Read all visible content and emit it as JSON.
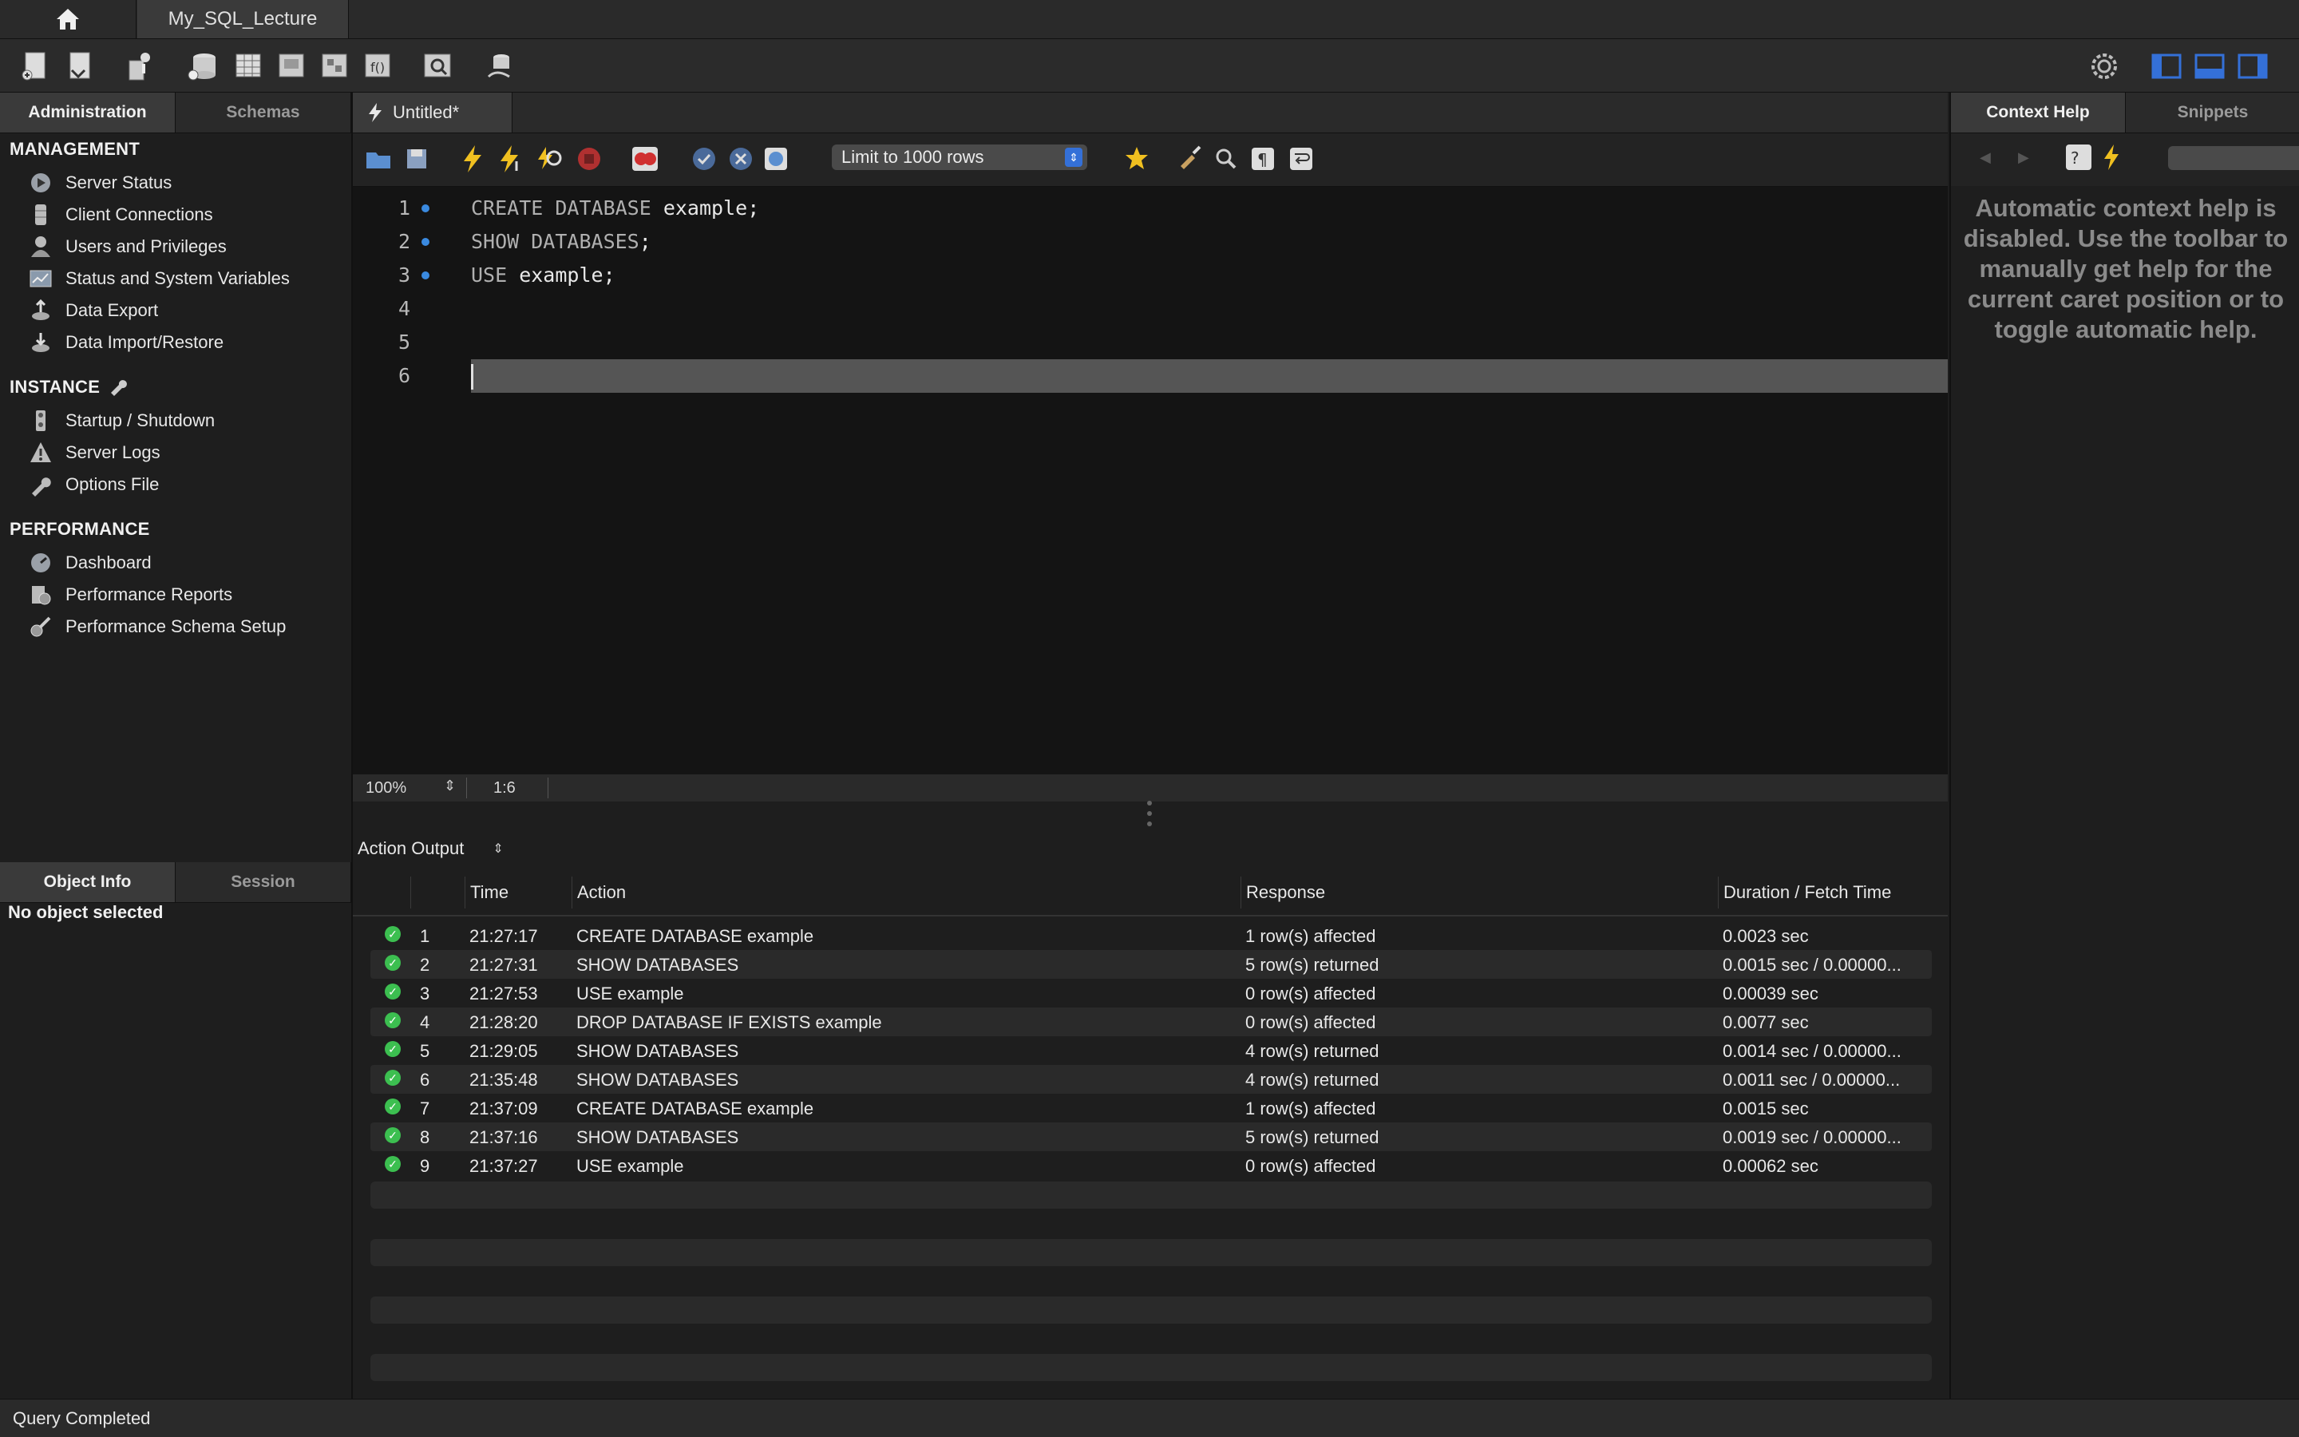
{
  "connection_tab": {
    "label": "My_SQL_Lecture"
  },
  "sidebar": {
    "top_tabs": [
      "Administration",
      "Schemas"
    ],
    "sections": [
      {
        "title": "MANAGEMENT",
        "items": [
          "Server Status",
          "Client Connections",
          "Users and Privileges",
          "Status and System Variables",
          "Data Export",
          "Data Import/Restore"
        ]
      },
      {
        "title": "INSTANCE",
        "items": [
          "Startup / Shutdown",
          "Server Logs",
          "Options File"
        ]
      },
      {
        "title": "PERFORMANCE",
        "items": [
          "Dashboard",
          "Performance Reports",
          "Performance Schema Setup"
        ]
      }
    ],
    "bottom_tabs": [
      "Object Info",
      "Session"
    ],
    "object_info": "No object selected"
  },
  "editor": {
    "tab_label": "Untitled*",
    "limit_label": "Limit to 1000 rows",
    "lines": [
      {
        "num": "1",
        "kw": "CREATE DATABASE",
        "rest": " example;",
        "marker": true
      },
      {
        "num": "2",
        "kw": "SHOW DATABASES",
        "rest": ";",
        "marker": true
      },
      {
        "num": "3",
        "kw": "USE",
        "rest": " example;",
        "marker": true
      },
      {
        "num": "4",
        "kw": "",
        "rest": "",
        "marker": false
      },
      {
        "num": "5",
        "kw": "",
        "rest": "",
        "marker": false
      },
      {
        "num": "6",
        "kw": "",
        "rest": "",
        "marker": false
      }
    ],
    "zoom": "100%",
    "cursor_pos": "1:6"
  },
  "output": {
    "selector": "Action Output",
    "columns": [
      "Time",
      "Action",
      "Response",
      "Duration / Fetch Time"
    ],
    "rows": [
      {
        "n": "1",
        "time": "21:27:17",
        "action": "CREATE DATABASE example",
        "response": "1 row(s) affected",
        "duration": "0.0023 sec"
      },
      {
        "n": "2",
        "time": "21:27:31",
        "action": "SHOW DATABASES",
        "response": "5 row(s) returned",
        "duration": "0.0015 sec / 0.00000..."
      },
      {
        "n": "3",
        "time": "21:27:53",
        "action": "USE example",
        "response": "0 row(s) affected",
        "duration": "0.00039 sec"
      },
      {
        "n": "4",
        "time": "21:28:20",
        "action": "DROP DATABASE IF EXISTS example",
        "response": "0 row(s) affected",
        "duration": "0.0077 sec"
      },
      {
        "n": "5",
        "time": "21:29:05",
        "action": "SHOW DATABASES",
        "response": "4 row(s) returned",
        "duration": "0.0014 sec / 0.00000..."
      },
      {
        "n": "6",
        "time": "21:35:48",
        "action": "SHOW DATABASES",
        "response": "4 row(s) returned",
        "duration": "0.0011 sec / 0.00000..."
      },
      {
        "n": "7",
        "time": "21:37:09",
        "action": "CREATE DATABASE example",
        "response": "1 row(s) affected",
        "duration": "0.0015 sec"
      },
      {
        "n": "8",
        "time": "21:37:16",
        "action": "SHOW DATABASES",
        "response": "5 row(s) returned",
        "duration": "0.0019 sec / 0.00000..."
      },
      {
        "n": "9",
        "time": "21:37:27",
        "action": "USE example",
        "response": "0 row(s) affected",
        "duration": "0.00062 sec"
      }
    ]
  },
  "right_panel": {
    "tabs": [
      "Context Help",
      "Snippets"
    ],
    "help_text": "Automatic context help is disabled. Use the toolbar to manually get help for the current caret position or to toggle automatic help."
  },
  "status_bar": {
    "text": "Query Completed"
  },
  "colors": {
    "accent_blue": "#3470d8",
    "success_green": "#3cbf50",
    "marker_blue": "#3a8ae0"
  }
}
